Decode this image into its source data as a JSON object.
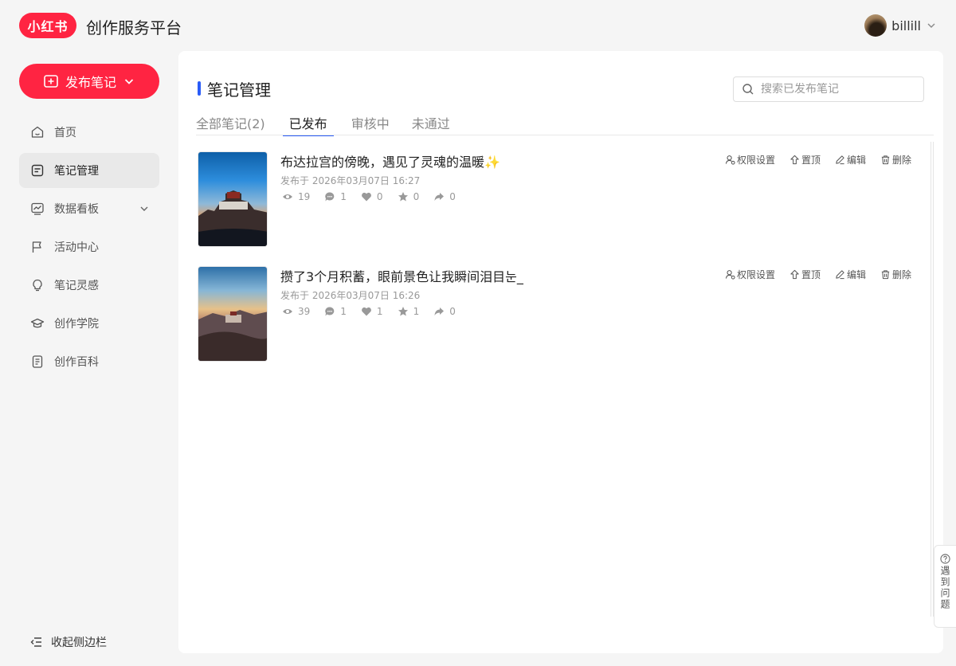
{
  "brand": {
    "logo_text": "小红书",
    "title": "创作服务平台"
  },
  "user": {
    "name": "billill"
  },
  "sidebar": {
    "publish_label": "发布笔记",
    "items": [
      {
        "label": "首页",
        "icon": "home-icon"
      },
      {
        "label": "笔记管理",
        "icon": "note-icon"
      },
      {
        "label": "数据看板",
        "icon": "chart-icon"
      },
      {
        "label": "活动中心",
        "icon": "flag-icon"
      },
      {
        "label": "笔记灵感",
        "icon": "bulb-icon"
      },
      {
        "label": "创作学院",
        "icon": "graduation-cap-icon"
      },
      {
        "label": "创作百科",
        "icon": "book-icon"
      }
    ],
    "active_index": 1,
    "collapse_label": "收起侧边栏"
  },
  "main": {
    "title": "笔记管理",
    "search_placeholder": "搜索已发布笔记",
    "tabs": [
      {
        "label": "全部笔记(2)"
      },
      {
        "label": "已发布"
      },
      {
        "label": "审核中"
      },
      {
        "label": "未通过"
      }
    ],
    "active_tab": 1,
    "action_labels": {
      "permission": "权限设置",
      "pin": "置顶",
      "edit": "编辑",
      "delete": "删除"
    },
    "notes": [
      {
        "title": "布达拉宫的傍晚，遇见了灵魂的温暖✨",
        "time": "发布于 2026年03月07日 16:27",
        "views": "19",
        "comments": "1",
        "likes": "0",
        "collects": "0",
        "shares": "0"
      },
      {
        "title": "攒了3个月积蓄，眼前景色让我瞬间泪目눈_",
        "time": "发布于 2026年03月07日 16:26",
        "views": "39",
        "comments": "1",
        "likes": "1",
        "collects": "1",
        "shares": "0"
      }
    ]
  },
  "help": {
    "label": "遇到问题"
  },
  "colors": {
    "brand_red": "#ff2442",
    "accent_blue": "#2a5cf7"
  }
}
